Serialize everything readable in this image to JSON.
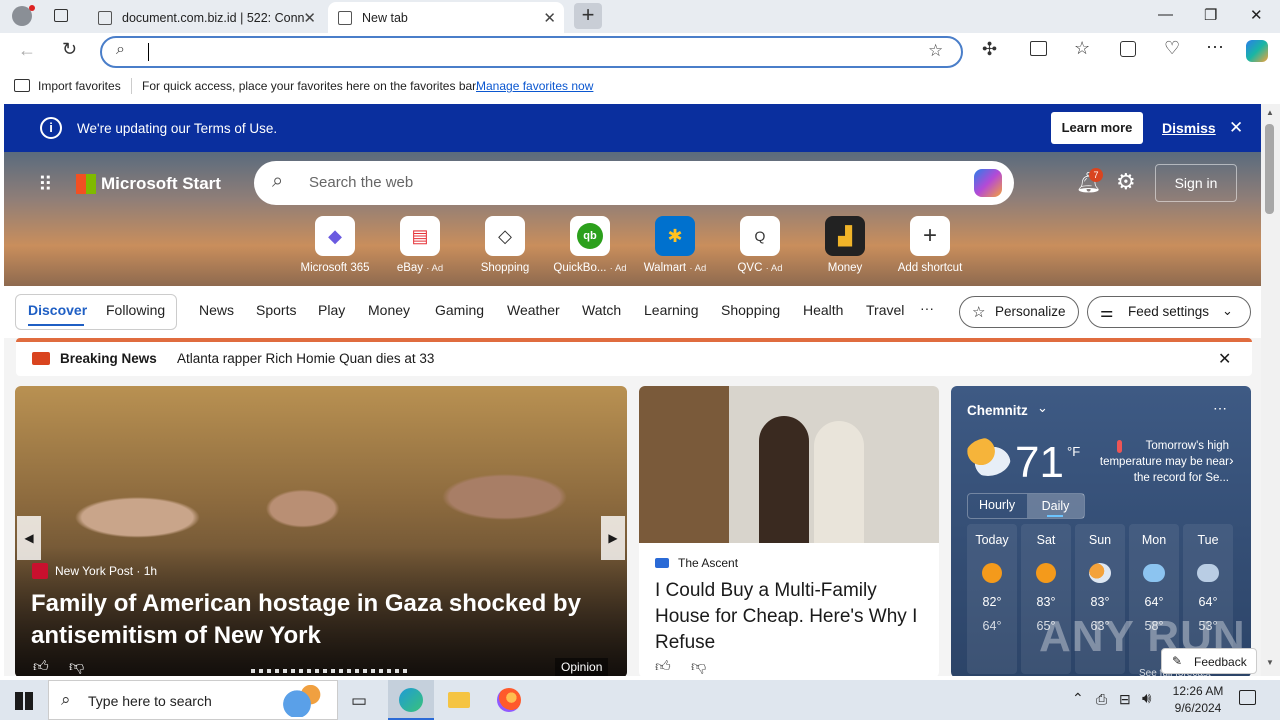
{
  "browser": {
    "tabs": [
      {
        "title": "document.com.biz.id | 522: Conn"
      },
      {
        "title": "New tab"
      }
    ],
    "favorites_bar": {
      "import_label": "Import favorites",
      "message": "For quick access, place your favorites here on the favorites bar.",
      "manage_link": "Manage favorites now"
    }
  },
  "notice": {
    "text": "We're updating our Terms of Use.",
    "learn_more": "Learn more",
    "dismiss": "Dismiss"
  },
  "header": {
    "brand": "Microsoft Start",
    "search_placeholder": "Search the web",
    "notification_count": "7",
    "sign_in": "Sign in"
  },
  "shortcuts": [
    {
      "label": "Microsoft 365",
      "ad": ""
    },
    {
      "label": "eBay",
      "ad": "· Ad"
    },
    {
      "label": "Shopping",
      "ad": ""
    },
    {
      "label": "QuickBo...",
      "ad": "· Ad"
    },
    {
      "label": "Walmart",
      "ad": "· Ad"
    },
    {
      "label": "QVC",
      "ad": "· Ad"
    },
    {
      "label": "Money",
      "ad": ""
    },
    {
      "label": "Add shortcut",
      "ad": ""
    }
  ],
  "nav": {
    "discover": "Discover",
    "following": "Following",
    "items": [
      "News",
      "Sports",
      "Play",
      "Money",
      "Gaming",
      "Weather",
      "Watch",
      "Learning",
      "Shopping",
      "Health",
      "Travel"
    ],
    "more": "···",
    "personalize": "Personalize",
    "feed_settings": "Feed settings"
  },
  "breaking": {
    "label": "Breaking News",
    "headline": "Atlanta rapper Rich Homie Quan dies at 33"
  },
  "hero_story": {
    "source": "New York Post · 1h",
    "headline": "Family of American hostage in Gaza shocked by antisemitism of New York",
    "tag": "Opinion"
  },
  "story2": {
    "source": "The Ascent",
    "headline": "I Could Buy a Multi-Family House for Cheap. Here's Why I Refuse"
  },
  "weather": {
    "city": "Chemnitz",
    "temp": "71",
    "unit": "°F",
    "note": "Tomorrow's high temperature may be near the record for Se...",
    "tab_hourly": "Hourly",
    "tab_daily": "Daily",
    "days": [
      {
        "day": "Today",
        "hi": "82°",
        "lo": "64°",
        "icon": "sun"
      },
      {
        "day": "Sat",
        "hi": "83°",
        "lo": "65°",
        "icon": "sun"
      },
      {
        "day": "Sun",
        "hi": "83°",
        "lo": "63°",
        "icon": "partly-cloudy"
      },
      {
        "day": "Mon",
        "hi": "64°",
        "lo": "58°",
        "icon": "rain"
      },
      {
        "day": "Tue",
        "hi": "64°",
        "lo": "53°",
        "icon": "rain"
      }
    ],
    "see_more": "See full forecast",
    "feedback": "Feedback"
  },
  "taskbar": {
    "search_placeholder": "Type here to search",
    "time": "12:26 AM",
    "date": "9/6/2024"
  },
  "watermark": "ANY RUN",
  "colors": {
    "accent": "#0a2f9e",
    "link": "#0b57d0",
    "breaking": "#e06c3f"
  }
}
